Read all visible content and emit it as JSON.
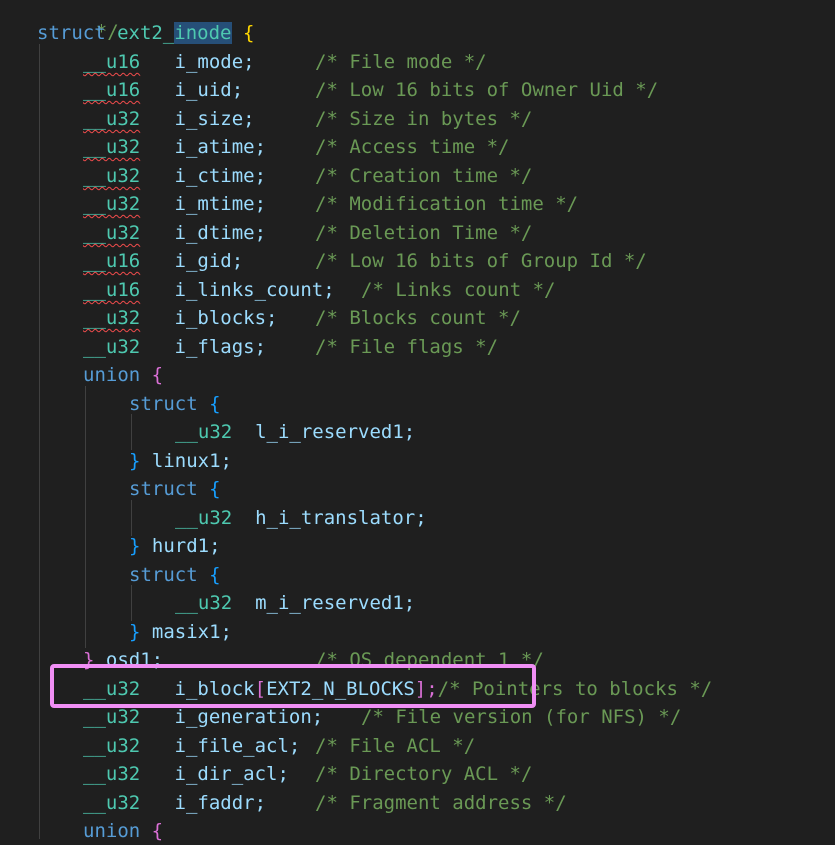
{
  "code": {
    "c_close": "*/",
    "l_struct": {
      "kw": "struct",
      "name_a": "ext2_",
      "name_b": "inode",
      "brace": "{"
    },
    "fields": [
      {
        "type": "__u16",
        "name": "i_mode;",
        "comment": "/* File mode */"
      },
      {
        "type": "__u16",
        "name": "i_uid;",
        "comment": "/* Low 16 bits of Owner Uid */"
      },
      {
        "type": "__u32",
        "name": "i_size;",
        "comment": "/* Size in bytes */"
      },
      {
        "type": "__u32",
        "name": "i_atime;",
        "comment": "/* Access time */"
      },
      {
        "type": "__u32",
        "name": "i_ctime;",
        "comment": "/* Creation time */"
      },
      {
        "type": "__u32",
        "name": "i_mtime;",
        "comment": "/* Modification time */"
      },
      {
        "type": "__u32",
        "name": "i_dtime;",
        "comment": "/* Deletion Time */"
      },
      {
        "type": "__u16",
        "name": "i_gid;",
        "comment": "/* Low 16 bits of Group Id */"
      },
      {
        "type": "__u16",
        "name": "i_links_count;",
        "comment": "/* Links count */"
      },
      {
        "type": "__u32",
        "name": "i_blocks;",
        "comment": "/* Blocks count */"
      },
      {
        "type": "__u32",
        "name": "i_flags;",
        "comment": "/* File flags */"
      }
    ],
    "union_kw": "union",
    "open_brace": "{",
    "close_brace": "}",
    "struct_kw": "struct",
    "u32": "__u32",
    "sub": [
      {
        "field": "l_i_reserved1;",
        "name": "linux1;"
      },
      {
        "field": "h_i_translator;",
        "name": "hurd1;"
      },
      {
        "field": "m_i_reserved1;",
        "name": "masix1;"
      }
    ],
    "osd1": {
      "name": "osd1;",
      "comment": "/* OS dependent 1 */"
    },
    "iblock": {
      "type": "__u32",
      "name": "i_block",
      "lbr": "[",
      "macro": "EXT2_N_BLOCKS",
      "rbr": "];",
      "comment": "/* Pointers to blocks */"
    },
    "fields2": [
      {
        "type": "__u32",
        "name": "i_generation;",
        "comment": "/* File version (for NFS) */"
      },
      {
        "type": "__u32",
        "name": "i_file_acl;",
        "comment": "/* File ACL */"
      },
      {
        "type": "__u32",
        "name": "i_dir_acl;",
        "comment": "/* Directory ACL */"
      },
      {
        "type": "__u32",
        "name": "i_faddr;",
        "comment": "/* Fragment address */"
      }
    ],
    "union2": {
      "kw": "union",
      "brace": "{"
    }
  }
}
